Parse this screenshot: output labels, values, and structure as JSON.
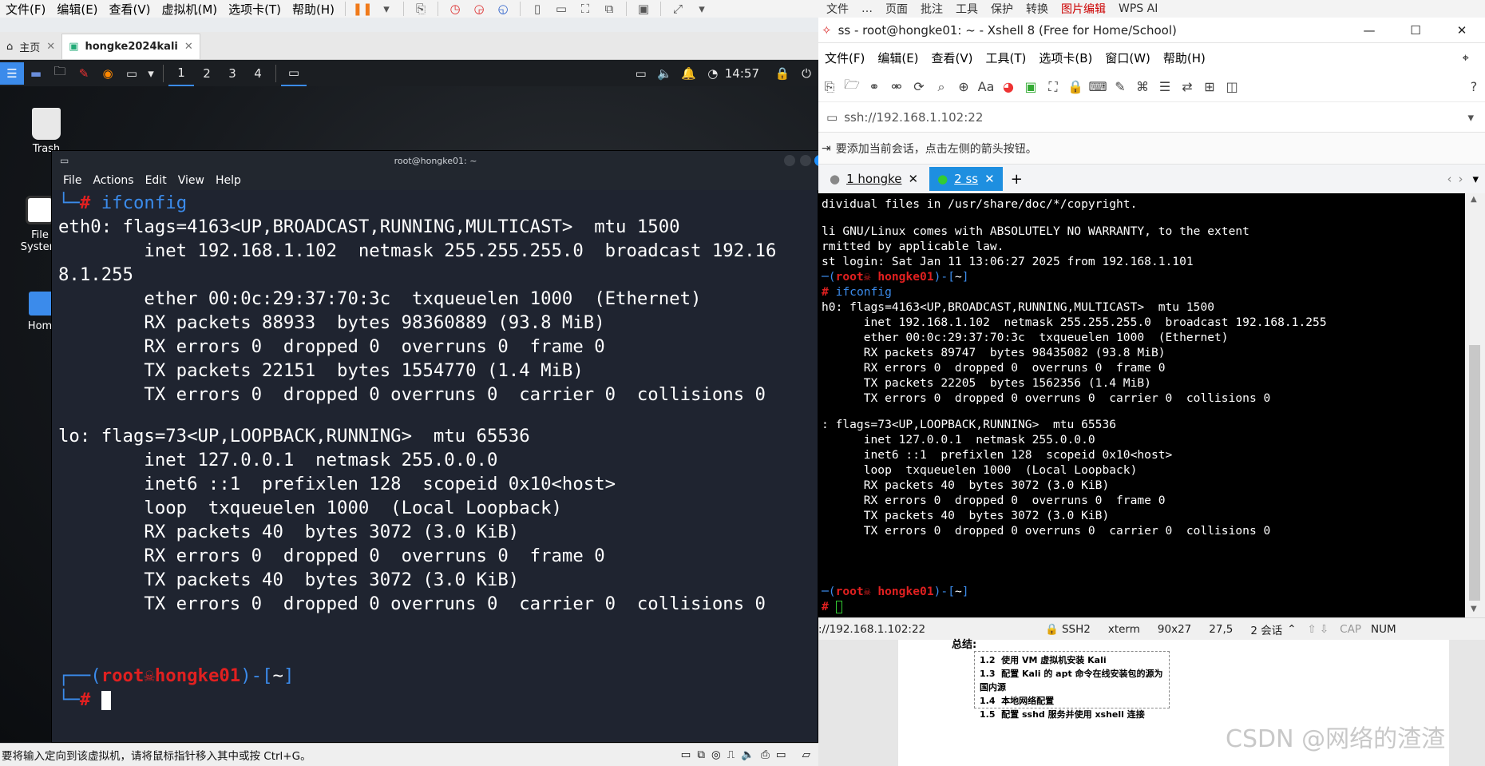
{
  "vmware": {
    "menu": [
      "文件(F)",
      "编辑(E)",
      "查看(V)",
      "虚拟机(M)",
      "选项卡(T)",
      "帮助(H)"
    ],
    "tabs": [
      {
        "label": "主页"
      },
      {
        "label": "hongke2024kali"
      }
    ],
    "status_text": "要将输入定向到该虚拟机，请将鼠标指针移入其中或按 Ctrl+G。"
  },
  "kali": {
    "workspaces": [
      "1",
      "2",
      "3",
      "4"
    ],
    "clock": "14:57",
    "desktop_icons": [
      {
        "label": "Trash",
        "icon": "trash-icon"
      },
      {
        "label": "File System",
        "icon": "drive-icon"
      },
      {
        "label": "Home",
        "icon": "home-folder-icon"
      }
    ]
  },
  "terminal": {
    "title": "root@hongke01: ~",
    "menu": [
      "File",
      "Actions",
      "Edit",
      "View",
      "Help"
    ],
    "command": "ifconfig",
    "output_lines": [
      "eth0: flags=4163<UP,BROADCAST,RUNNING,MULTICAST>  mtu 1500",
      "        inet 192.168.1.102  netmask 255.255.255.0  broadcast 192.16",
      "8.1.255",
      "        ether 00:0c:29:37:70:3c  txqueuelen 1000  (Ethernet)",
      "        RX packets 88933  bytes 98360889 (93.8 MiB)",
      "        RX errors 0  dropped 0  overruns 0  frame 0",
      "        TX packets 22151  bytes 1554770 (1.4 MiB)",
      "        TX errors 0  dropped 0 overruns 0  carrier 0  collisions 0",
      "",
      "lo: flags=73<UP,LOOPBACK,RUNNING>  mtu 65536",
      "        inet 127.0.0.1  netmask 255.0.0.0",
      "        inet6 ::1  prefixlen 128  scopeid 0x10<host>",
      "        loop  txqueuelen 1000  (Local Loopback)",
      "        RX packets 40  bytes 3072 (3.0 KiB)",
      "        RX errors 0  dropped 0  overruns 0  frame 0",
      "        TX packets 40  bytes 3072 (3.0 KiB)",
      "        TX errors 0  dropped 0 overruns 0  carrier 0  collisions 0"
    ],
    "prompt_user": "root",
    "prompt_host": "hongke01",
    "prompt_dir": "~"
  },
  "xshell": {
    "top_items": [
      "文件",
      "…",
      "页面",
      "批注",
      "工具",
      "保护",
      "转换",
      "图片编辑",
      "WPS AI"
    ],
    "title": "ss - root@hongke01: ~ - Xshell 8 (Free for Home/School)",
    "menu": [
      "文件(F)",
      "编辑(E)",
      "查看(V)",
      "工具(T)",
      "选项卡(B)",
      "窗口(W)",
      "帮助(H)"
    ],
    "address": "ssh://192.168.1.102:22",
    "hint": "要添加当前会话，点击左侧的箭头按钮。",
    "tabs": [
      {
        "label": "1 hongke"
      },
      {
        "label": "2 ss"
      }
    ],
    "terminal_lines": [
      "dividual files in /usr/share/doc/*/copyright.",
      "",
      "li GNU/Linux comes with ABSOLUTELY NO WARRANTY, to the extent",
      "rmitted by applicable law.",
      "st login: Sat Jan 11 13:06:27 2025 from 192.168.1.101"
    ],
    "command": "ifconfig",
    "output_lines": [
      "h0: flags=4163<UP,BROADCAST,RUNNING,MULTICAST>  mtu 1500",
      "      inet 192.168.1.102  netmask 255.255.255.0  broadcast 192.168.1.255",
      "      ether 00:0c:29:37:70:3c  txqueuelen 1000  (Ethernet)",
      "      RX packets 89747  bytes 98435082 (93.8 MiB)",
      "      RX errors 0  dropped 0  overruns 0  frame 0",
      "      TX packets 22205  bytes 1562356 (1.4 MiB)",
      "      TX errors 0  dropped 0 overruns 0  carrier 0  collisions 0",
      "",
      ": flags=73<UP,LOOPBACK,RUNNING>  mtu 65536",
      "      inet 127.0.0.1  netmask 255.0.0.0",
      "      inet6 ::1  prefixlen 128  scopeid 0x10<host>",
      "      loop  txqueuelen 1000  (Local Loopback)",
      "      RX packets 40  bytes 3072 (3.0 KiB)",
      "      RX errors 0  dropped 0  overruns 0  frame 0",
      "      TX packets 40  bytes 3072 (3.0 KiB)",
      "      TX errors 0  dropped 0 overruns 0  carrier 0  collisions 0"
    ],
    "prompt_user": "root",
    "prompt_host": "hongke01",
    "prompt_dir": "~",
    "status": {
      "address": "://192.168.1.102:22",
      "protocol": "SSH2",
      "term": "xterm",
      "size": "90x27",
      "cursor": "27,5",
      "sessions": "2 会话",
      "caps": "CAP",
      "num": "NUM"
    }
  },
  "document": {
    "heading": "总结:",
    "toc": [
      {
        "num": "1.2",
        "text": "使用 VM 虚拟机安装 Kali"
      },
      {
        "num": "1.3",
        "text": "配置 Kali 的 apt 命令在线安装包的源为国内源"
      },
      {
        "num": "1.4",
        "text": "本地网络配置"
      },
      {
        "num": "1.5",
        "text": "配置 sshd 服务并使用 xshell 连接"
      }
    ],
    "watermark": "CSDN @网络的渣渣"
  },
  "colors": {
    "kali_prompt_blue": "#3b8beb",
    "kali_prompt_red": "#e02020",
    "xshell_tab_active": "#1e8fe0"
  }
}
